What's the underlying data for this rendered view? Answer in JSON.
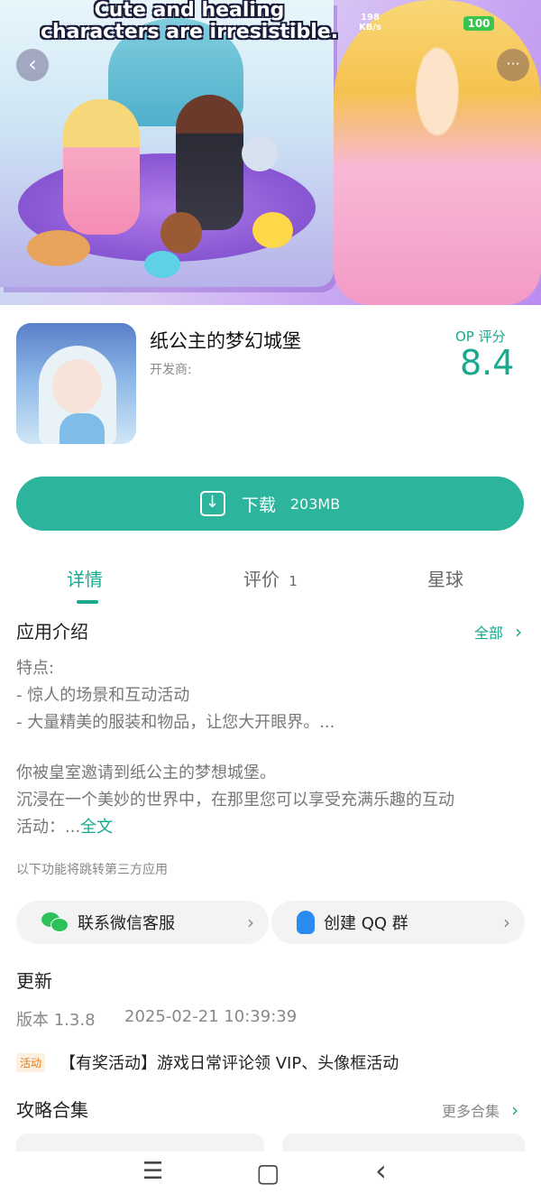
{
  "banner": {
    "caption": "Cute and healing characters are irresistible.",
    "speed_value": "198",
    "speed_unit": "KB/s",
    "battery": "100",
    "back_symbol": "‹",
    "more_symbol": "···"
  },
  "app": {
    "title": "纸公主的梦幻城堡",
    "developer_label": "开发商:",
    "rating_label": "OP 评分",
    "rating_value": "8.4"
  },
  "download": {
    "label": "下载",
    "size": "203MB"
  },
  "tabs": [
    {
      "label": "详情",
      "count": "",
      "active": true
    },
    {
      "label": "评价",
      "count": "1",
      "active": false
    },
    {
      "label": "星球",
      "count": "",
      "active": false
    }
  ],
  "intro": {
    "title": "应用介绍",
    "all_link": "全部",
    "chevron": "›",
    "lines": [
      "特点:",
      "- 惊人的场景和互动活动",
      "- 大量精美的服装和物品，让您大开眼界。..."
    ],
    "para1": "你被皇室邀请到纸公主的梦想城堡。",
    "para2": "沉浸在一个美妙的世界中，在那里您可以享受充满乐趣的互动",
    "para3_prefix": "活动：...",
    "para3_link": "全文",
    "third_party_note": "以下功能将跳转第三方应用"
  },
  "third_party": [
    {
      "label": "联系微信客服",
      "icon": "wechat-icon"
    },
    {
      "label": "创建 QQ 群",
      "icon": "qq-icon"
    }
  ],
  "update": {
    "title": "更新",
    "version": "版本 1.3.8",
    "date": "2025-02-21 10:39:39"
  },
  "activity": {
    "badge": "活动",
    "text": "【有奖活动】游戏日常评论领 VIP、头像框活动"
  },
  "guides": {
    "title": "攻略合集",
    "more_link": "更多合集"
  },
  "nav": {
    "menu_symbol": "☰",
    "home_symbol": "▢",
    "back_symbol": "‹"
  },
  "colors": {
    "accent": "#19a98e",
    "download_button": "#2cb59c",
    "activity_badge": "#e07b1a"
  }
}
